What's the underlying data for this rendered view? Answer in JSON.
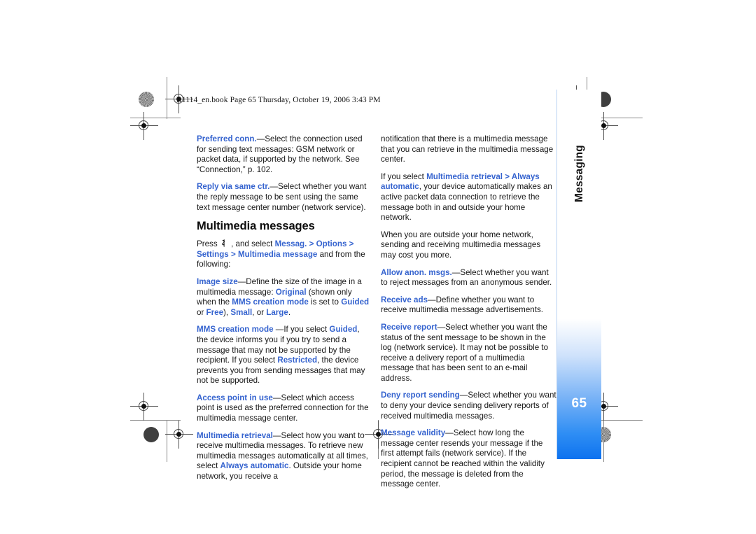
{
  "slug": {
    "text": "R1114_en.book  Page 65  Thursday, October 19, 2006  3:43 PM"
  },
  "side_tab": {
    "label": "Messaging",
    "page_number": "65",
    "accent_color": "#0d72ef"
  },
  "colors": {
    "link": "#3664cf",
    "text": "#171717",
    "tab_blue": "#0d72ef",
    "rule_blue": "#b9d2f2"
  },
  "section": {
    "title": "Multimedia messages"
  },
  "icons": {
    "menu_key": "menu-key-icon"
  },
  "left_column": {
    "paragraphs": [
      {
        "id": "preferred-conn",
        "runs": [
          {
            "t": "Preferred conn.",
            "s": "link"
          },
          {
            "t": "—Select the connection used for sending text messages: GSM network or packet data, if supported by the network. See “Connection,” p. 102.",
            "s": "body"
          }
        ]
      },
      {
        "id": "reply-via-same-ctr",
        "runs": [
          {
            "t": "Reply via same ctr.",
            "s": "link"
          },
          {
            "t": "—Select whether you want the reply message to be sent using the same text message center number (network service).",
            "s": "body"
          }
        ]
      },
      {
        "id": "press-instruction",
        "runs": [
          {
            "t": "Press ",
            "s": "body"
          },
          {
            "t": "",
            "s": "icon-menu-key"
          },
          {
            "t": " , and select ",
            "s": "body"
          },
          {
            "t": "Messag.",
            "s": "link"
          },
          {
            "t": " > ",
            "s": "link"
          },
          {
            "t": "Options",
            "s": "link"
          },
          {
            "t": " > ",
            "s": "link"
          },
          {
            "t": "Settings",
            "s": "link"
          },
          {
            "t": " > ",
            "s": "link"
          },
          {
            "t": "Multimedia message",
            "s": "link"
          },
          {
            "t": " and from the following:",
            "s": "body"
          }
        ]
      },
      {
        "id": "image-size",
        "runs": [
          {
            "t": "Image size",
            "s": "link"
          },
          {
            "t": "—Define the size of the image in a multimedia message: ",
            "s": "body"
          },
          {
            "t": "Original",
            "s": "link"
          },
          {
            "t": " (shown only when the ",
            "s": "body"
          },
          {
            "t": "MMS creation mode",
            "s": "link"
          },
          {
            "t": " is set to ",
            "s": "body"
          },
          {
            "t": "Guided",
            "s": "link"
          },
          {
            "t": " or ",
            "s": "body"
          },
          {
            "t": "Free",
            "s": "link"
          },
          {
            "t": "), ",
            "s": "body"
          },
          {
            "t": "Small",
            "s": "link"
          },
          {
            "t": ", or ",
            "s": "body"
          },
          {
            "t": "Large",
            "s": "link"
          },
          {
            "t": ".",
            "s": "body"
          }
        ]
      },
      {
        "id": "mms-creation-mode",
        "runs": [
          {
            "t": "MMS creation mode",
            "s": "link"
          },
          {
            "t": " —If you select ",
            "s": "body"
          },
          {
            "t": "Guided",
            "s": "link"
          },
          {
            "t": ", the device informs you if you try to send a message that may not be supported by the recipient. If you select ",
            "s": "body"
          },
          {
            "t": "Restricted",
            "s": "link"
          },
          {
            "t": ", the device prevents you from sending messages that may not be supported.",
            "s": "body"
          }
        ]
      },
      {
        "id": "access-point-in-use",
        "runs": [
          {
            "t": "Access point in use",
            "s": "link"
          },
          {
            "t": "—Select which access point is used as the preferred connection for the multimedia message center.",
            "s": "body"
          }
        ]
      },
      {
        "id": "multimedia-retrieval",
        "runs": [
          {
            "t": "Multimedia retrieval",
            "s": "link"
          },
          {
            "t": "—Select how you want to receive multimedia messages. To retrieve new multimedia messages automatically at all times, select ",
            "s": "body"
          },
          {
            "t": "Always automatic",
            "s": "link"
          },
          {
            "t": ". Outside your home network, you receive a",
            "s": "body"
          }
        ]
      }
    ]
  },
  "right_column": {
    "paragraphs": [
      {
        "id": "notification-continued",
        "runs": [
          {
            "t": "notification that there is a multimedia message that you can retrieve in the multimedia message center.",
            "s": "body"
          }
        ]
      },
      {
        "id": "if-you-select-retrieval",
        "runs": [
          {
            "t": "If you select ",
            "s": "body"
          },
          {
            "t": "Multimedia retrieval",
            "s": "link"
          },
          {
            "t": " > ",
            "s": "link"
          },
          {
            "t": "Always automatic",
            "s": "link"
          },
          {
            "t": ", your device automatically makes an active packet data connection to retrieve the message both in and outside your home network.",
            "s": "body"
          }
        ]
      },
      {
        "id": "outside-home-network-cost",
        "runs": [
          {
            "t": "When you are outside your home network, sending and receiving multimedia messages may cost you more.",
            "s": "body"
          }
        ]
      },
      {
        "id": "allow-anon-msgs",
        "runs": [
          {
            "t": "Allow anon. msgs.",
            "s": "link"
          },
          {
            "t": "—Select whether you want to reject messages from an anonymous sender.",
            "s": "body"
          }
        ]
      },
      {
        "id": "receive-ads",
        "runs": [
          {
            "t": "Receive ads",
            "s": "link"
          },
          {
            "t": "—Define whether you want to receive multimedia message advertisements.",
            "s": "body"
          }
        ]
      },
      {
        "id": "receive-report",
        "runs": [
          {
            "t": "Receive report",
            "s": "link"
          },
          {
            "t": "—Select whether you want the status of the sent message to be shown in the log (network service). It may not be possible to receive a delivery report of a multimedia message that has been sent to an e-mail address.",
            "s": "body"
          }
        ]
      },
      {
        "id": "deny-report-sending",
        "runs": [
          {
            "t": "Deny report sending",
            "s": "link"
          },
          {
            "t": "—Select whether you want to deny your device sending delivery reports of received multimedia messages.",
            "s": "body"
          }
        ]
      },
      {
        "id": "message-validity",
        "runs": [
          {
            "t": "Message validity",
            "s": "link"
          },
          {
            "t": "—Select how long the message center resends your message if the first attempt fails (network service). If the recipient cannot be reached within the validity period, the message is deleted from the message center.",
            "s": "body"
          }
        ]
      }
    ]
  }
}
